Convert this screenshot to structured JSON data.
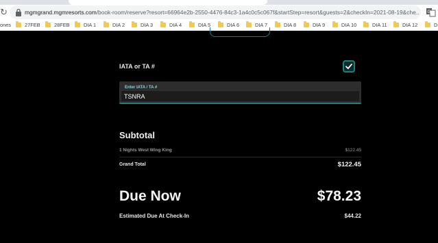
{
  "browser": {
    "url_host": "mgmgrand.mgmresorts.com",
    "url_path": "/book-room/reserve?resort=66964e2b-2550-4476-84c3-1a4c0c5c067f&startStep=resort&guests=2&checkIn=2021-08-19&che...",
    "bookmarks": {
      "first": "ones",
      "items": [
        "27FEB",
        "28FEB",
        "DIA 1",
        "DIA 2",
        "DIA 3",
        "DIA 4",
        "DIA 5",
        "DIA 6",
        "DIA 7",
        "DIA 8",
        "DIA 9",
        "DIA 10",
        "DIA 11",
        "DIA 12",
        "D"
      ]
    }
  },
  "iata": {
    "label": "IATA or TA #",
    "checked": true,
    "field_label": "Enter IATA / TA #",
    "field_value": "TSNRA"
  },
  "summary": {
    "subtotal_heading": "Subtotal",
    "room_line_label": "1 Nights West Wing King",
    "room_line_value": "$122.45",
    "grand_total_label": "Grand Total",
    "grand_total_value": "$122.45",
    "due_now_label": "Due Now",
    "due_now_value": "$78.23",
    "est_due_label": "Estimated Due At Check-In",
    "est_due_value": "$44.22"
  },
  "colors": {
    "accent": "#1c7f80",
    "background": "#000000"
  }
}
